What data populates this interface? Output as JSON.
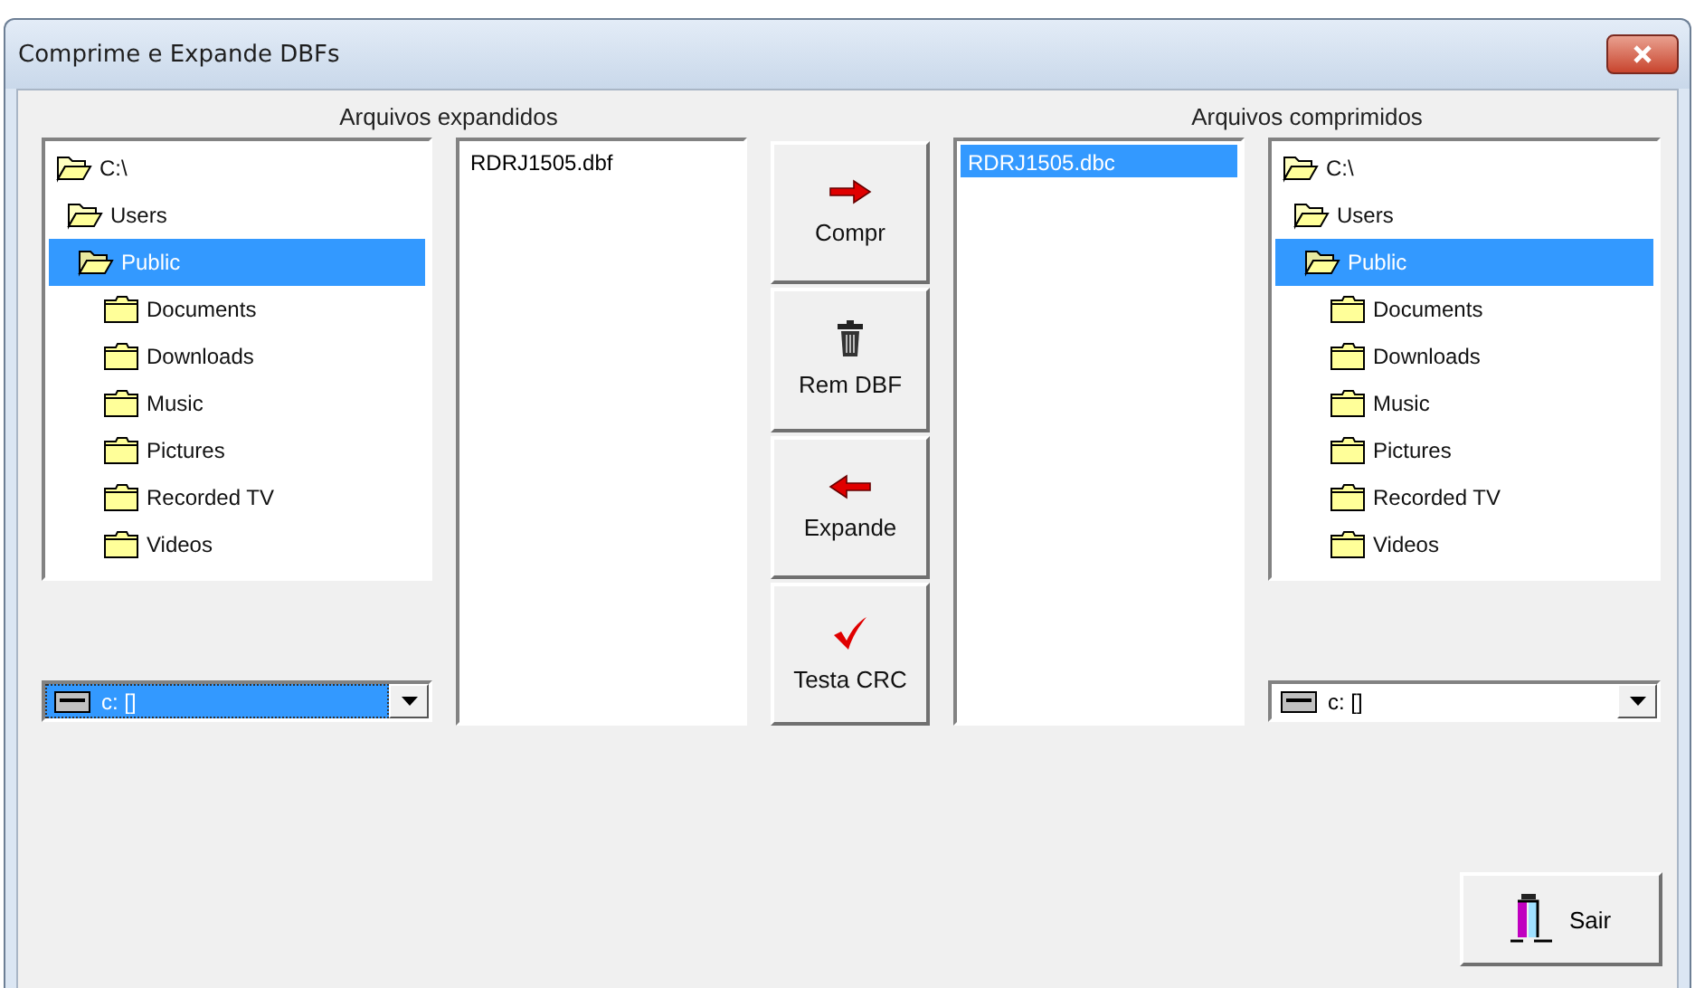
{
  "window": {
    "title": "Comprime e Expande DBFs"
  },
  "left": {
    "heading": "Arquivos expandidos",
    "tree": [
      {
        "label": "C:\\",
        "expanded": true,
        "selected": false,
        "children": [
          {
            "label": "Users",
            "expanded": true,
            "selected": false,
            "children": [
              {
                "label": "Public",
                "expanded": true,
                "selected": true,
                "children": [
                  {
                    "label": "Documents",
                    "expanded": false,
                    "selected": false
                  },
                  {
                    "label": "Downloads",
                    "expanded": false,
                    "selected": false
                  },
                  {
                    "label": "Music",
                    "expanded": false,
                    "selected": false
                  },
                  {
                    "label": "Pictures",
                    "expanded": false,
                    "selected": false
                  },
                  {
                    "label": "Recorded TV",
                    "expanded": false,
                    "selected": false
                  },
                  {
                    "label": "Videos",
                    "expanded": false,
                    "selected": false
                  }
                ]
              }
            ]
          }
        ]
      }
    ],
    "files": [
      {
        "name": "RDRJ1505.dbf",
        "selected": false
      }
    ],
    "drive": {
      "value": "c: []",
      "focused": true
    }
  },
  "actions": [
    {
      "label": "Compr",
      "kind": "right-arrow"
    },
    {
      "label": "Rem DBF",
      "kind": "trash"
    },
    {
      "label": "Expande",
      "kind": "left-arrow"
    },
    {
      "label": "Testa CRC",
      "kind": "check"
    }
  ],
  "right": {
    "heading": "Arquivos comprimidos",
    "files": [
      {
        "name": "RDRJ1505.dbc",
        "selected": true
      }
    ],
    "tree": [
      {
        "label": "C:\\",
        "expanded": true,
        "selected": false,
        "children": [
          {
            "label": "Users",
            "expanded": true,
            "selected": false,
            "children": [
              {
                "label": "Public",
                "expanded": true,
                "selected": true,
                "children": [
                  {
                    "label": "Documents",
                    "expanded": false,
                    "selected": false
                  },
                  {
                    "label": "Downloads",
                    "expanded": false,
                    "selected": false
                  },
                  {
                    "label": "Music",
                    "expanded": false,
                    "selected": false
                  },
                  {
                    "label": "Pictures",
                    "expanded": false,
                    "selected": false
                  },
                  {
                    "label": "Recorded TV",
                    "expanded": false,
                    "selected": false
                  },
                  {
                    "label": "Videos",
                    "expanded": false,
                    "selected": false
                  }
                ]
              }
            ]
          }
        ]
      }
    ],
    "drive": {
      "value": "c: []",
      "focused": false
    }
  },
  "exit_button": {
    "label": "Sair"
  }
}
